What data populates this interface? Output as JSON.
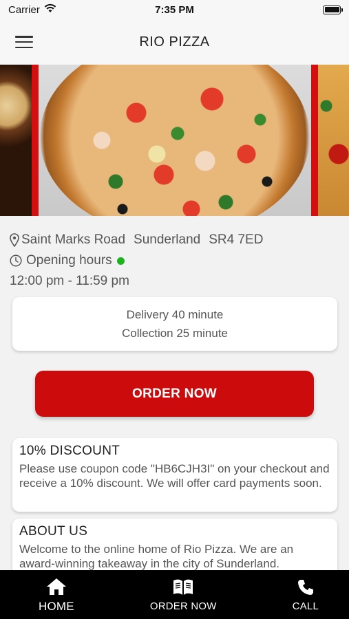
{
  "status_bar": {
    "carrier": "Carrier",
    "time": "7:35 PM"
  },
  "header": {
    "title": "RIO PIZZA"
  },
  "location": {
    "street": "Saint Marks Road",
    "city": "Sunderland",
    "postcode": "SR4 7ED"
  },
  "hours": {
    "label": "Opening hours",
    "is_open": true,
    "open_color": "#1db31d",
    "times": "12:00 pm - 11:59 pm"
  },
  "delivery_card": {
    "delivery": "Delivery 40 minute",
    "collection": "Collection 25 minute"
  },
  "order_button": {
    "label": "ORDER NOW",
    "color": "#cc0c0c"
  },
  "discount": {
    "title": "10% DISCOUNT",
    "text": "Please use coupon code \"HB6CJH3I\" on your checkout and receive a 10% discount. We will offer card payments soon."
  },
  "about": {
    "title": "ABOUT US",
    "text": "Welcome to the online home of Rio Pizza. We are an award-winning takeaway in the city of Sunderland."
  },
  "tab_bar": {
    "items": [
      {
        "label": "HOME",
        "icon": "home-icon"
      },
      {
        "label": "ORDER NOW",
        "icon": "menu-book-icon"
      },
      {
        "label": "CALL",
        "icon": "phone-icon"
      }
    ]
  }
}
